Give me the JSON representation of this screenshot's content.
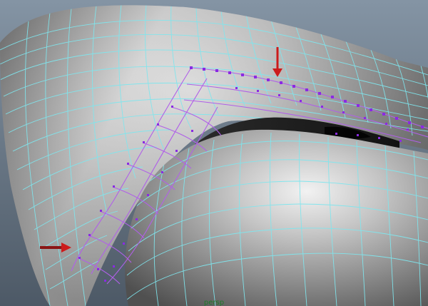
{
  "viewport": {
    "camera_label": "persp",
    "background_color": "#6e7c8c",
    "wireframe_color": "#7fe6ee",
    "selected_edge_color": "#b060e8",
    "selected_vertex_color": "#8a2be2",
    "annotation_arrow_color": "#cc1b1b"
  },
  "annotations": {
    "arrows": [
      "red-arrow-down-icon",
      "red-arrow-right-icon"
    ]
  }
}
